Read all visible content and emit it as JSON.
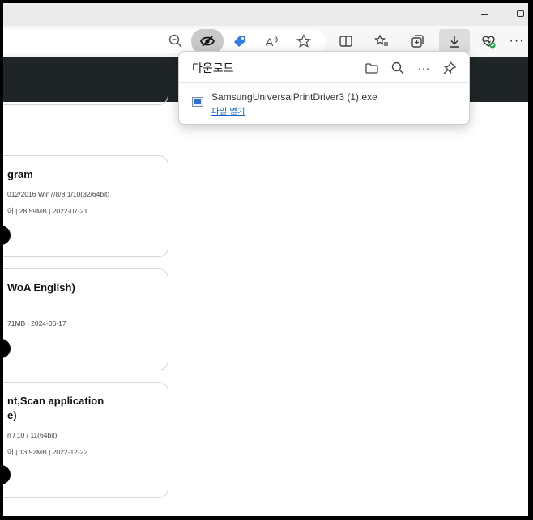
{
  "browser": {
    "toolbar_icons": [
      "zoom-out-icon",
      "tracking-hidden-icon",
      "coupon-tag-icon",
      "read-aloud-icon",
      "favorite-star-icon",
      "split-screen-icon",
      "favorites-list-icon",
      "collections-icon",
      "downloads-icon",
      "browser-essentials-icon",
      "more-menu-icon"
    ],
    "read_aloud_glyph": "A",
    "more_glyph": "···"
  },
  "download_panel": {
    "title": "다운로드",
    "actions": [
      "folder-icon",
      "search-icon",
      "more-icon",
      "pin-icon"
    ],
    "more_glyph": "···",
    "items": [
      {
        "file_name": "SamsungUniversalPrintDriver3 (1).exe",
        "action_label": "파일 열기"
      }
    ]
  },
  "page": {
    "cards": [
      {
        "title_lines": [
          "gram"
        ],
        "meta_lines": [
          "012/2016 Win7/8/8.1/10(32/64bit)",
          "어  |  28.59MB  |  2022-07-21"
        ]
      },
      {
        "title_lines": [
          "WoA English)"
        ],
        "meta_lines": [
          "71MB  |  2024-06-17"
        ]
      },
      {
        "title_lines": [
          "nt,Scan application",
          "e)"
        ],
        "meta_lines": [
          "n / 10 / 11(64bit)",
          "어  |  13.92MB  |  2022-12-22"
        ]
      }
    ]
  },
  "colors": {
    "dark_nav": "#1f2426",
    "link": "#0b62c4",
    "accent_badge": "#2f7fe8",
    "health_green": "#1aa34a"
  }
}
